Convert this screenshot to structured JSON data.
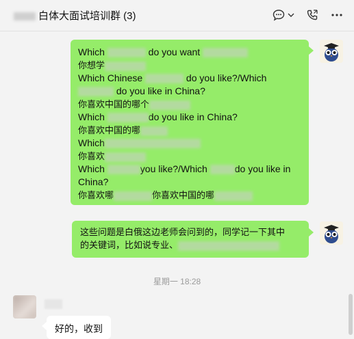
{
  "header": {
    "title": "白体大面试培训群 (3)",
    "icons": [
      "chat-bubble-icon",
      "chevron-down-icon",
      "phone-icon",
      "more-icon"
    ]
  },
  "messages": {
    "first": {
      "lines": [
        "Which ",
        " do you want ",
        "你想学",
        "Which Chinese ",
        " do you like?/Which",
        " do you like in China?",
        "你喜欢中国的哪个",
        "Which ",
        "do you like in China?",
        "你喜欢中国的哪",
        "Which",
        "你喜欢",
        "Which ",
        "you like?/Which ",
        "do you like in",
        "China?",
        "你喜欢哪",
        "你喜欢中国的哪"
      ]
    },
    "second": {
      "line1": "这些问题是白俄这边老师会问到的，同学记一下其中",
      "line2": "的关键词，比如说专业、"
    },
    "timestamp": "星期一 18:28",
    "reply": "好的，收到"
  }
}
